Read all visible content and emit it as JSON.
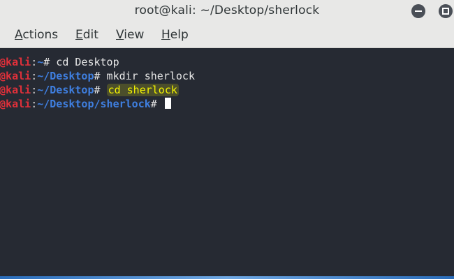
{
  "window": {
    "title": "root@kali: ~/Desktop/sherlock"
  },
  "menubar": {
    "items": [
      {
        "mnemonic": "A",
        "rest": "ctions"
      },
      {
        "mnemonic": "E",
        "rest": "dit"
      },
      {
        "mnemonic": "V",
        "rest": "iew"
      },
      {
        "mnemonic": "H",
        "rest": "elp"
      }
    ]
  },
  "terminal": {
    "lines": [
      {
        "user": "t@kali",
        "sep": ":",
        "path": "~",
        "cmd": "# cd Desktop"
      },
      {
        "user": "t@kali",
        "sep": ":",
        "path": "~/Desktop",
        "cmd": "# mkdir sherlock"
      },
      {
        "user": "t@kali",
        "sep": ":",
        "path": "~/Desktop",
        "cmd": "# ",
        "highlighted": "cd sherlock"
      },
      {
        "user": "t@kali",
        "sep": ":",
        "path": "~/Desktop/sherlock",
        "cmd": "# "
      }
    ]
  },
  "colors": {
    "user": "#e0303a",
    "path": "#3f7fe0",
    "highlight_text": "#f5f500",
    "terminal_bg": "#262a33",
    "chrome_bg": "#e8e8e7"
  },
  "icons": {
    "minimize": "minimize-icon",
    "maximize": "maximize-icon"
  }
}
